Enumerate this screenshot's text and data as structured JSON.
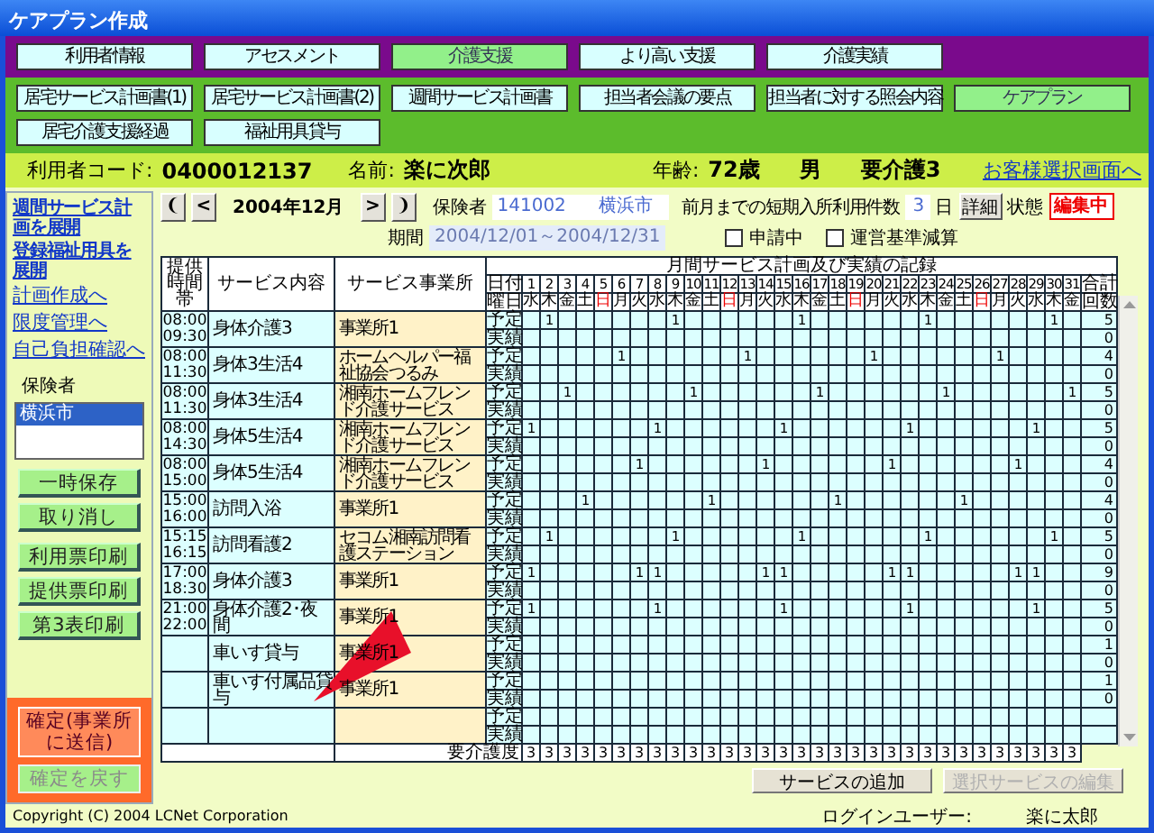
{
  "window": {
    "title": "ケアプラン作成"
  },
  "main_tabs": [
    {
      "label": "利用者情報",
      "selected": false
    },
    {
      "label": "アセスメント",
      "selected": false
    },
    {
      "label": "介護支援",
      "selected": true
    },
    {
      "label": "より高い支援",
      "selected": false
    },
    {
      "label": "介護実績",
      "selected": false
    }
  ],
  "sub_tabs": [
    {
      "label": "居宅サービス計画書(1)",
      "selected": false
    },
    {
      "label": "居宅サービス計画書(2)",
      "selected": false
    },
    {
      "label": "週間サービス計画書",
      "selected": false
    },
    {
      "label": "担当者会議の要点",
      "selected": false
    },
    {
      "label": "担当者に対する照会内容",
      "selected": false
    },
    {
      "label": "ケアプラン",
      "selected": true
    },
    {
      "label": "居宅介護支援経過",
      "selected": false
    },
    {
      "label": "福祉用具貸与",
      "selected": false
    }
  ],
  "client": {
    "code_label": "利用者コード:",
    "code": "0400012137",
    "name_label": "名前:",
    "name": "楽に次郎",
    "age_label": "年齢:",
    "age": "72歳",
    "sex": "男",
    "care_level": "要介護3",
    "link": "お客様選択画面へ"
  },
  "sidebar": {
    "links": [
      {
        "label": "週間サービス計画を展開",
        "kind": "small"
      },
      {
        "label": "登録福祉用具を展開",
        "kind": "small"
      },
      {
        "label": "計画作成へ",
        "kind": "large"
      },
      {
        "label": "限度管理へ",
        "kind": "large"
      },
      {
        "label": "自己負担確認へ",
        "kind": "large"
      }
    ],
    "insurer_label": "保険者",
    "insurer_list": [
      {
        "label": "横浜市",
        "selected": true
      }
    ],
    "edit_buttons": [
      "一時保存",
      "取り消し"
    ],
    "print_buttons": [
      "利用票印刷",
      "提供票印刷",
      "第3表印刷"
    ],
    "confirm_buttons": [
      {
        "label": "確定(事業所に送信)",
        "disabled": false
      },
      {
        "label": "確定を戻す",
        "disabled": true
      }
    ]
  },
  "month_nav": {
    "first": "❨",
    "prev": "<",
    "month": "2004年12月",
    "next": ">",
    "last": "❩"
  },
  "insurer": {
    "label": "保険者",
    "code": "141002",
    "name": "横浜市"
  },
  "period": {
    "label": "期間",
    "value": "2004/12/01～2004/12/31"
  },
  "short_stay": {
    "label": "前月までの短期入所利用件数",
    "value": "3",
    "unit": "日",
    "detail_button": "詳細"
  },
  "status": {
    "label": "状態",
    "value": "編集中"
  },
  "checkboxes": [
    {
      "label": "申請中",
      "checked": false
    },
    {
      "label": "運営基準減算",
      "checked": false
    }
  ],
  "table": {
    "columns": [
      "提供時間帯",
      "サービス内容",
      "サービス事業所"
    ],
    "record_title": "月間サービス計画及び実績の記録",
    "date_label": "日付",
    "weekday_label": "曜日",
    "total_label": "合計",
    "count_label": "回数",
    "days": [
      {
        "day": "1",
        "weekday": "水",
        "sunday": false
      },
      {
        "day": "2",
        "weekday": "木",
        "sunday": false
      },
      {
        "day": "3",
        "weekday": "金",
        "sunday": false
      },
      {
        "day": "4",
        "weekday": "土",
        "sunday": false
      },
      {
        "day": "5",
        "weekday": "日",
        "sunday": true
      },
      {
        "day": "6",
        "weekday": "月",
        "sunday": false
      },
      {
        "day": "7",
        "weekday": "火",
        "sunday": false
      },
      {
        "day": "8",
        "weekday": "水",
        "sunday": false
      },
      {
        "day": "9",
        "weekday": "木",
        "sunday": false
      },
      {
        "day": "10",
        "weekday": "金",
        "sunday": false
      },
      {
        "day": "11",
        "weekday": "土",
        "sunday": false
      },
      {
        "day": "12",
        "weekday": "日",
        "sunday": true
      },
      {
        "day": "13",
        "weekday": "月",
        "sunday": false
      },
      {
        "day": "14",
        "weekday": "火",
        "sunday": false
      },
      {
        "day": "15",
        "weekday": "水",
        "sunday": false
      },
      {
        "day": "16",
        "weekday": "木",
        "sunday": false
      },
      {
        "day": "17",
        "weekday": "金",
        "sunday": false
      },
      {
        "day": "18",
        "weekday": "土",
        "sunday": false
      },
      {
        "day": "19",
        "weekday": "日",
        "sunday": true
      },
      {
        "day": "20",
        "weekday": "月",
        "sunday": false
      },
      {
        "day": "21",
        "weekday": "火",
        "sunday": false
      },
      {
        "day": "22",
        "weekday": "水",
        "sunday": false
      },
      {
        "day": "23",
        "weekday": "木",
        "sunday": false
      },
      {
        "day": "24",
        "weekday": "金",
        "sunday": false
      },
      {
        "day": "25",
        "weekday": "土",
        "sunday": false
      },
      {
        "day": "26",
        "weekday": "日",
        "sunday": true
      },
      {
        "day": "27",
        "weekday": "月",
        "sunday": false
      },
      {
        "day": "28",
        "weekday": "火",
        "sunday": false
      },
      {
        "day": "29",
        "weekday": "水",
        "sunday": false
      },
      {
        "day": "30",
        "weekday": "木",
        "sunday": false
      },
      {
        "day": "31",
        "weekday": "金",
        "sunday": false
      }
    ],
    "rows": [
      {
        "start": "08:00",
        "end": "09:30",
        "service": "身体介護3",
        "provider": "事業所1",
        "plan_label": "予定",
        "plan": [
          {
            "marked": false
          },
          {
            "marked": true,
            "value": "1"
          },
          {
            "marked": false
          },
          {
            "marked": false
          },
          {
            "marked": false
          },
          {
            "marked": false
          },
          {
            "marked": false
          },
          {
            "marked": false
          },
          {
            "marked": true,
            "value": "1"
          },
          {
            "marked": false
          },
          {
            "marked": false
          },
          {
            "marked": false
          },
          {
            "marked": false
          },
          {
            "marked": false
          },
          {
            "marked": false
          },
          {
            "marked": true,
            "value": "1"
          },
          {
            "marked": false
          },
          {
            "marked": false
          },
          {
            "marked": false
          },
          {
            "marked": false
          },
          {
            "marked": false
          },
          {
            "marked": false
          },
          {
            "marked": true,
            "value": "1"
          },
          {
            "marked": false
          },
          {
            "marked": false
          },
          {
            "marked": false
          },
          {
            "marked": false
          },
          {
            "marked": false
          },
          {
            "marked": false
          },
          {
            "marked": true,
            "value": "1"
          },
          {
            "marked": false
          }
        ],
        "plan_total": "5",
        "actual_label": "実績",
        "actual_total": "0"
      },
      {
        "start": "08:00",
        "end": "11:30",
        "service": "身体3生活4",
        "provider": "ホームヘルパー福祉協会つるみ",
        "plan_label": "予定",
        "plan": [
          {
            "marked": false
          },
          {
            "marked": false
          },
          {
            "marked": false
          },
          {
            "marked": false
          },
          {
            "marked": false
          },
          {
            "marked": true,
            "value": "1"
          },
          {
            "marked": false
          },
          {
            "marked": false
          },
          {
            "marked": false
          },
          {
            "marked": false
          },
          {
            "marked": false
          },
          {
            "marked": false
          },
          {
            "marked": true,
            "value": "1"
          },
          {
            "marked": false
          },
          {
            "marked": false
          },
          {
            "marked": false
          },
          {
            "marked": false
          },
          {
            "marked": false
          },
          {
            "marked": false
          },
          {
            "marked": true,
            "value": "1"
          },
          {
            "marked": false
          },
          {
            "marked": false
          },
          {
            "marked": false
          },
          {
            "marked": false
          },
          {
            "marked": false
          },
          {
            "marked": false
          },
          {
            "marked": true,
            "value": "1"
          },
          {
            "marked": false
          },
          {
            "marked": false
          },
          {
            "marked": false
          },
          {
            "marked": false
          }
        ],
        "plan_total": "4",
        "actual_label": "実績",
        "actual_total": "0"
      },
      {
        "start": "08:00",
        "end": "11:30",
        "service": "身体3生活4",
        "provider": "湘南ホームフレンド介護サービス",
        "plan_label": "予定",
        "plan": [
          {
            "marked": false
          },
          {
            "marked": false
          },
          {
            "marked": true,
            "value": "1"
          },
          {
            "marked": false
          },
          {
            "marked": false
          },
          {
            "marked": false
          },
          {
            "marked": false
          },
          {
            "marked": false
          },
          {
            "marked": false
          },
          {
            "marked": true,
            "value": "1"
          },
          {
            "marked": false
          },
          {
            "marked": false
          },
          {
            "marked": false
          },
          {
            "marked": false
          },
          {
            "marked": false
          },
          {
            "marked": false
          },
          {
            "marked": true,
            "value": "1"
          },
          {
            "marked": false
          },
          {
            "marked": false
          },
          {
            "marked": false
          },
          {
            "marked": false
          },
          {
            "marked": false
          },
          {
            "marked": false
          },
          {
            "marked": true,
            "value": "1"
          },
          {
            "marked": false
          },
          {
            "marked": false
          },
          {
            "marked": false
          },
          {
            "marked": false
          },
          {
            "marked": false
          },
          {
            "marked": false
          },
          {
            "marked": true,
            "value": "1"
          }
        ],
        "plan_total": "5",
        "actual_label": "実績",
        "actual_total": "0"
      },
      {
        "start": "08:00",
        "end": "14:30",
        "service": "身体5生活4",
        "provider": "湘南ホームフレンド介護サービス",
        "plan_label": "予定",
        "plan": [
          {
            "marked": true,
            "value": "1"
          },
          {
            "marked": false
          },
          {
            "marked": false
          },
          {
            "marked": false
          },
          {
            "marked": false
          },
          {
            "marked": false
          },
          {
            "marked": false
          },
          {
            "marked": true,
            "value": "1"
          },
          {
            "marked": false
          },
          {
            "marked": false
          },
          {
            "marked": false
          },
          {
            "marked": false
          },
          {
            "marked": false
          },
          {
            "marked": false
          },
          {
            "marked": true,
            "value": "1"
          },
          {
            "marked": false
          },
          {
            "marked": false
          },
          {
            "marked": false
          },
          {
            "marked": false
          },
          {
            "marked": false
          },
          {
            "marked": false
          },
          {
            "marked": true,
            "value": "1"
          },
          {
            "marked": false
          },
          {
            "marked": false
          },
          {
            "marked": false
          },
          {
            "marked": false
          },
          {
            "marked": false
          },
          {
            "marked": false
          },
          {
            "marked": true,
            "value": "1"
          },
          {
            "marked": false
          },
          {
            "marked": false
          }
        ],
        "plan_total": "5",
        "actual_label": "実績",
        "actual_total": "0"
      },
      {
        "start": "08:00",
        "end": "15:00",
        "service": "身体5生活4",
        "provider": "湘南ホームフレンド介護サービス",
        "plan_label": "予定",
        "plan": [
          {
            "marked": false
          },
          {
            "marked": false
          },
          {
            "marked": false
          },
          {
            "marked": false
          },
          {
            "marked": false
          },
          {
            "marked": false
          },
          {
            "marked": true,
            "value": "1"
          },
          {
            "marked": false
          },
          {
            "marked": false
          },
          {
            "marked": false
          },
          {
            "marked": false
          },
          {
            "marked": false
          },
          {
            "marked": false
          },
          {
            "marked": true,
            "value": "1"
          },
          {
            "marked": false
          },
          {
            "marked": false
          },
          {
            "marked": false
          },
          {
            "marked": false
          },
          {
            "marked": false
          },
          {
            "marked": false
          },
          {
            "marked": true,
            "value": "1"
          },
          {
            "marked": false
          },
          {
            "marked": false
          },
          {
            "marked": false
          },
          {
            "marked": false
          },
          {
            "marked": false
          },
          {
            "marked": false
          },
          {
            "marked": true,
            "value": "1"
          },
          {
            "marked": false
          },
          {
            "marked": false
          },
          {
            "marked": false
          }
        ],
        "plan_total": "4",
        "actual_label": "実績",
        "actual_total": "0"
      },
      {
        "start": "15:00",
        "end": "16:00",
        "service": "訪問入浴",
        "provider": "事業所1",
        "plan_label": "予定",
        "plan": [
          {
            "marked": false
          },
          {
            "marked": false
          },
          {
            "marked": false
          },
          {
            "marked": true,
            "value": "1"
          },
          {
            "marked": false
          },
          {
            "marked": false
          },
          {
            "marked": false
          },
          {
            "marked": false
          },
          {
            "marked": false
          },
          {
            "marked": false
          },
          {
            "marked": true,
            "value": "1"
          },
          {
            "marked": false
          },
          {
            "marked": false
          },
          {
            "marked": false
          },
          {
            "marked": false
          },
          {
            "marked": false
          },
          {
            "marked": false
          },
          {
            "marked": true,
            "value": "1"
          },
          {
            "marked": false
          },
          {
            "marked": false
          },
          {
            "marked": false
          },
          {
            "marked": false
          },
          {
            "marked": false
          },
          {
            "marked": false
          },
          {
            "marked": true,
            "value": "1"
          },
          {
            "marked": false
          },
          {
            "marked": false
          },
          {
            "marked": false
          },
          {
            "marked": false
          },
          {
            "marked": false
          },
          {
            "marked": false
          }
        ],
        "plan_total": "4",
        "actual_label": "実績",
        "actual_total": "0"
      },
      {
        "start": "15:15",
        "end": "16:15",
        "service": "訪問看護2",
        "provider": "セコム湘南訪問看護ステーション",
        "plan_label": "予定",
        "plan": [
          {
            "marked": false
          },
          {
            "marked": true,
            "value": "1"
          },
          {
            "marked": false
          },
          {
            "marked": false
          },
          {
            "marked": false
          },
          {
            "marked": false
          },
          {
            "marked": false
          },
          {
            "marked": false
          },
          {
            "marked": true,
            "value": "1"
          },
          {
            "marked": false
          },
          {
            "marked": false
          },
          {
            "marked": false
          },
          {
            "marked": false
          },
          {
            "marked": false
          },
          {
            "marked": false
          },
          {
            "marked": true,
            "value": "1"
          },
          {
            "marked": false
          },
          {
            "marked": false
          },
          {
            "marked": false
          },
          {
            "marked": false
          },
          {
            "marked": false
          },
          {
            "marked": false
          },
          {
            "marked": true,
            "value": "1"
          },
          {
            "marked": false
          },
          {
            "marked": false
          },
          {
            "marked": false
          },
          {
            "marked": false
          },
          {
            "marked": false
          },
          {
            "marked": false
          },
          {
            "marked": true,
            "value": "1"
          },
          {
            "marked": false
          }
        ],
        "plan_total": "5",
        "actual_label": "実績",
        "actual_total": "0"
      },
      {
        "start": "17:00",
        "end": "18:30",
        "service": "身体介護3",
        "provider": "事業所1",
        "plan_label": "予定",
        "plan": [
          {
            "marked": true,
            "value": "1"
          },
          {
            "marked": false
          },
          {
            "marked": false
          },
          {
            "marked": false
          },
          {
            "marked": false
          },
          {
            "marked": false
          },
          {
            "marked": true,
            "value": "1"
          },
          {
            "marked": true,
            "value": "1"
          },
          {
            "marked": false
          },
          {
            "marked": false
          },
          {
            "marked": false
          },
          {
            "marked": false
          },
          {
            "marked": false
          },
          {
            "marked": true,
            "value": "1"
          },
          {
            "marked": true,
            "value": "1"
          },
          {
            "marked": false
          },
          {
            "marked": false
          },
          {
            "marked": false
          },
          {
            "marked": false
          },
          {
            "marked": false
          },
          {
            "marked": true,
            "value": "1"
          },
          {
            "marked": true,
            "value": "1"
          },
          {
            "marked": false
          },
          {
            "marked": false
          },
          {
            "marked": false
          },
          {
            "marked": false
          },
          {
            "marked": false
          },
          {
            "marked": true,
            "value": "1"
          },
          {
            "marked": true,
            "value": "1"
          },
          {
            "marked": false
          },
          {
            "marked": false
          }
        ],
        "plan_total": "9",
        "actual_label": "実績",
        "actual_total": "0"
      },
      {
        "start": "21:00",
        "end": "22:00",
        "service": "身体介護2･夜間",
        "provider": "事業所1",
        "plan_label": "予定",
        "plan": [
          {
            "marked": true,
            "value": "1"
          },
          {
            "marked": false
          },
          {
            "marked": false
          },
          {
            "marked": false
          },
          {
            "marked": false
          },
          {
            "marked": false
          },
          {
            "marked": false
          },
          {
            "marked": true,
            "value": "1"
          },
          {
            "marked": false
          },
          {
            "marked": false
          },
          {
            "marked": false
          },
          {
            "marked": false
          },
          {
            "marked": false
          },
          {
            "marked": false
          },
          {
            "marked": true,
            "value": "1"
          },
          {
            "marked": false
          },
          {
            "marked": false
          },
          {
            "marked": false
          },
          {
            "marked": false
          },
          {
            "marked": false
          },
          {
            "marked": false
          },
          {
            "marked": true,
            "value": "1"
          },
          {
            "marked": false
          },
          {
            "marked": false
          },
          {
            "marked": false
          },
          {
            "marked": false
          },
          {
            "marked": false
          },
          {
            "marked": false
          },
          {
            "marked": true,
            "value": "1"
          },
          {
            "marked": false
          },
          {
            "marked": false
          }
        ],
        "plan_total": "5",
        "actual_label": "実績",
        "actual_total": "0"
      },
      {
        "service": "車いす貸与",
        "provider": "事業所1",
        "plan_label": "予定",
        "plan_total": "1",
        "actual_label": "実績",
        "actual_total": "0"
      },
      {
        "service": "車いす付属品貸与",
        "provider": "事業所1",
        "plan_label": "予定",
        "plan_total": "1",
        "actual_label": "実績",
        "actual_total": "0"
      },
      {
        "plan_label": "予定",
        "actual_label": "実績"
      }
    ],
    "care_level_label": "要介護度",
    "care_levels": [
      "3",
      "3",
      "3",
      "3",
      "3",
      "3",
      "3",
      "3",
      "3",
      "3",
      "3",
      "3",
      "3",
      "3",
      "3",
      "3",
      "3",
      "3",
      "3",
      "3",
      "3",
      "3",
      "3",
      "3",
      "3",
      "3",
      "3",
      "3",
      "3",
      "3",
      "3"
    ]
  },
  "action_buttons": [
    {
      "label": "サービスの追加",
      "disabled": false
    },
    {
      "label": "選択サービスの編集",
      "disabled": true
    }
  ],
  "footer": {
    "copyright": "Copyright (C) 2004 LCNet Corporation",
    "login_label": "ログインユーザー:",
    "login_user": "楽に太郎"
  }
}
